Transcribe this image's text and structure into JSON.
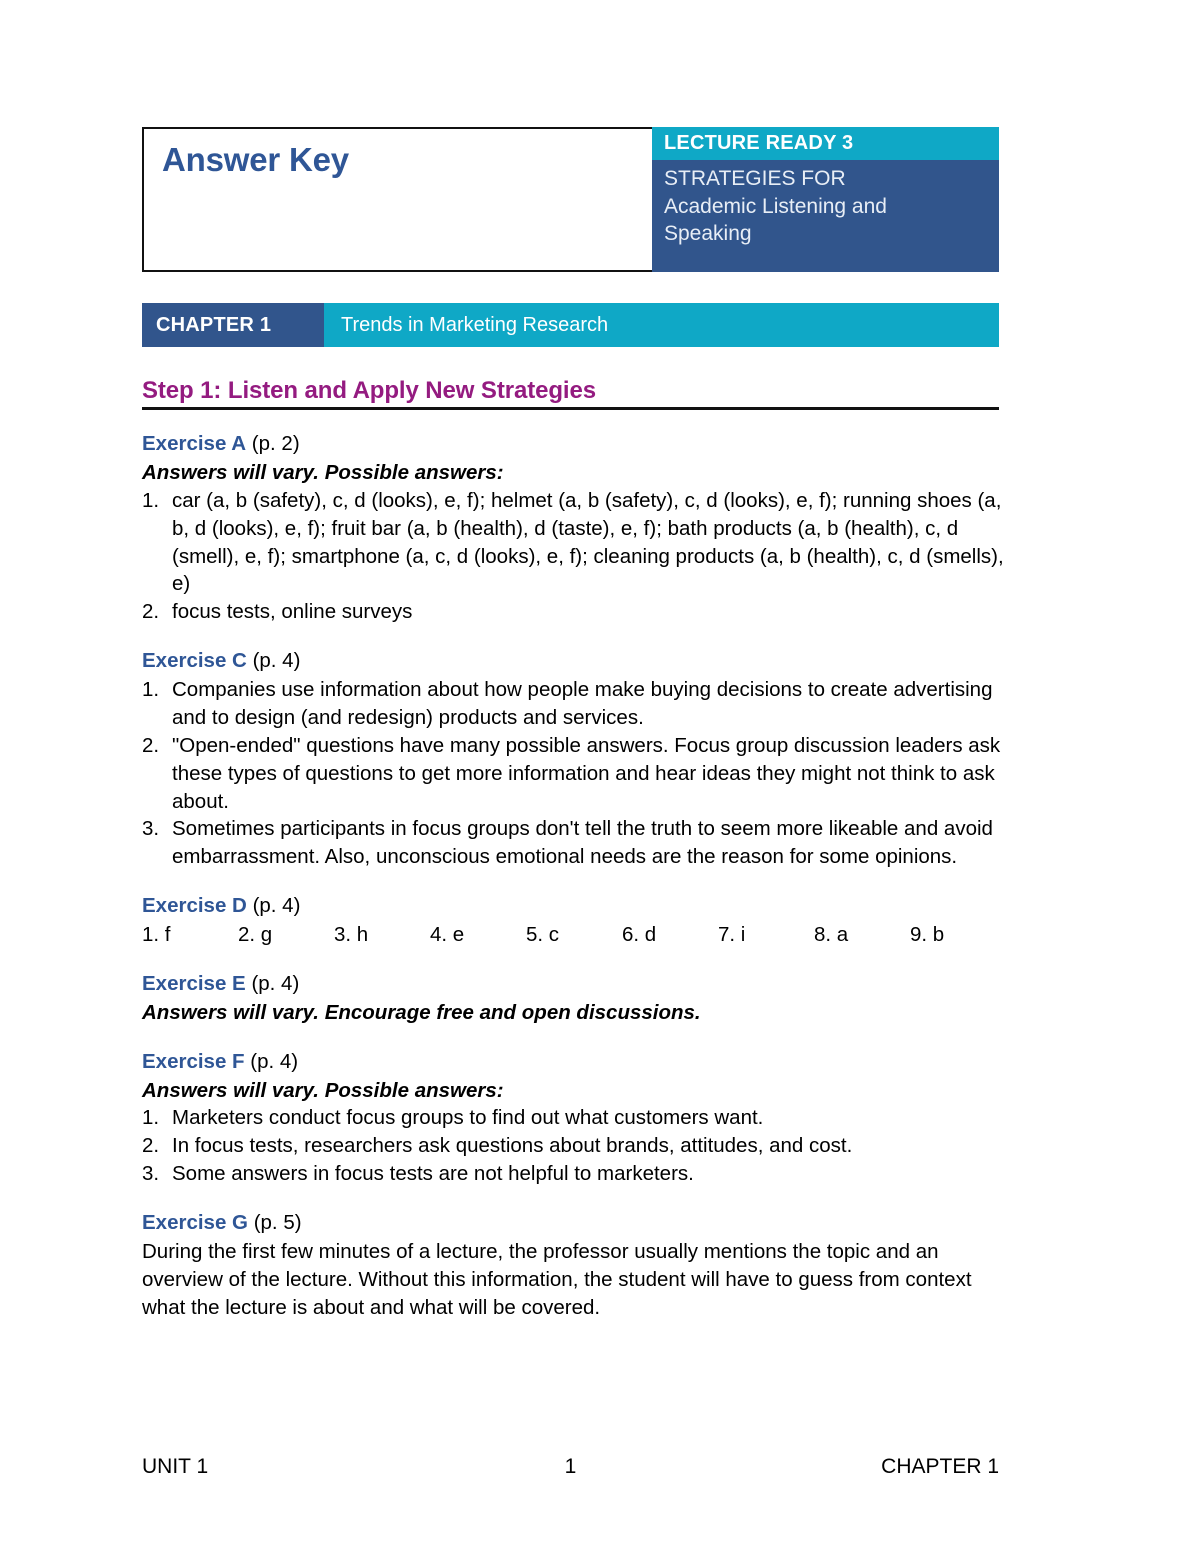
{
  "document": {
    "title": "Answer Key",
    "brand": {
      "series": "LECTURE READY 3",
      "subtitle_line1": "STRATEGIES FOR",
      "subtitle_line2": "Academic Listening and",
      "subtitle_line3": "Speaking"
    },
    "chapter": {
      "label": "CHAPTER 1",
      "title": "Trends in Marketing Research"
    },
    "step_heading": "Step 1: Listen and Apply New Strategies"
  },
  "exercises": [
    {
      "name": "Exercise A",
      "page": "(p. 2)",
      "note": "Answers will vary. Possible answers:",
      "items": [
        {
          "num": "1.",
          "text": "car (a, b (safety), c, d (looks), e, f); helmet (a, b (safety), c, d (looks), e, f); running shoes (a, b, d (looks), e, f); fruit bar (a, b (health), d (taste), e, f); bath products (a, b (health), c, d (smell), e, f); smartphone (a, c, d (looks), e, f); cleaning products (a, b (health), c, d (smells), e)"
        },
        {
          "num": "2.",
          "text": "focus tests, online surveys"
        }
      ]
    },
    {
      "name": "Exercise C",
      "page": "(p. 4)",
      "items": [
        {
          "num": "1.",
          "text": "Companies use information about how people make buying decisions to create advertising and to design (and redesign) products and services."
        },
        {
          "num": "2.",
          "text": "\"Open-ended\" questions have many possible answers. Focus group discussion leaders ask these types of questions to get more information and hear ideas they might not think to ask about."
        },
        {
          "num": "3.",
          "text": "Sometimes participants in focus groups don't tell the truth to seem more likeable and avoid embarrassment. Also, unconscious emotional needs are the reason for some opinions."
        }
      ]
    },
    {
      "name": "Exercise D",
      "page": "(p. 4)",
      "matching_answers": [
        "1. f",
        "2. g",
        "3. h",
        "4. e",
        "5. c",
        "6. d",
        "7. i",
        "8. a",
        "9. b"
      ]
    },
    {
      "name": "Exercise E",
      "page": "(p. 4)",
      "note": "Answers will vary. Encourage free and open discussions."
    },
    {
      "name": "Exercise F",
      "page": "(p. 4)",
      "note": "Answers will vary. Possible answers:",
      "items": [
        {
          "num": "1.",
          "text": "Marketers conduct focus groups to find out what customers want."
        },
        {
          "num": "2.",
          "text": "In focus tests, researchers ask questions about brands, attitudes, and cost."
        },
        {
          "num": "3.",
          "text": "Some answers in focus tests are not helpful to marketers."
        }
      ]
    },
    {
      "name": "Exercise G",
      "page": "(p. 5)",
      "paragraph": "During the first few minutes of a lecture, the professor usually mentions the topic and an overview of the lecture. Without this information, the student will have to guess from context what the lecture is about and what will be covered."
    }
  ],
  "footer": {
    "left": "UNIT 1",
    "center": "1",
    "right": "CHAPTER 1"
  },
  "colors": {
    "teal": "#0fa8c6",
    "navy": "#31558c",
    "heading_blue": "#2f5696",
    "step_purple": "#941b80",
    "text_black": "#000000"
  }
}
